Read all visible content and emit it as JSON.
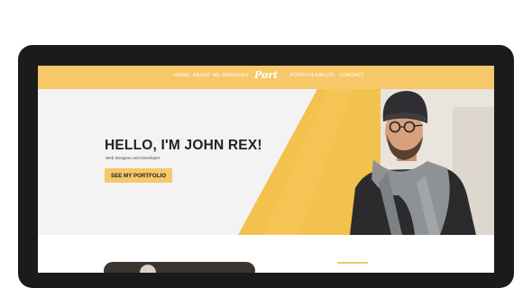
{
  "nav": {
    "left_items": [
      "HOME",
      "ABOUT ME",
      "SERVICES"
    ],
    "logo": "Port",
    "right_items": [
      "PORTFOLIO",
      "BLOG",
      "CONTACT"
    ]
  },
  "hero": {
    "title": "HELLO, I'M JOHN REX!",
    "subtitle": "Web Designer and Developer",
    "cta_label": "SEE MY PORTFOLIO"
  },
  "colors": {
    "accent": "#f6c86a",
    "bezel": "#1b1b1b",
    "hero_bg": "#f3f3f3",
    "wall_yellow": "#f2c14e"
  }
}
